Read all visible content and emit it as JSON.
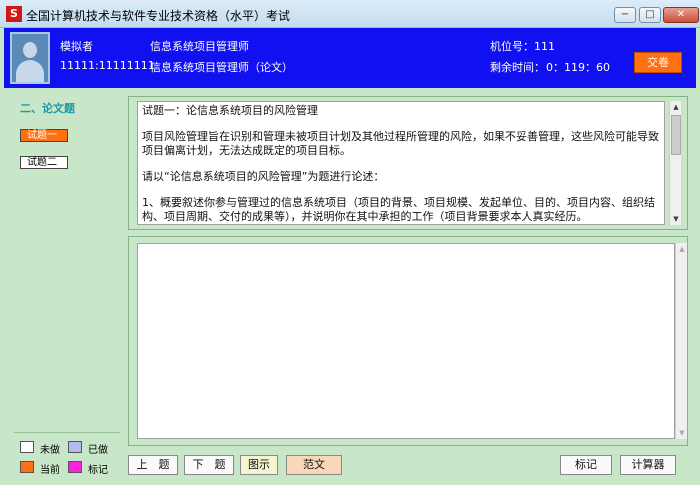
{
  "window": {
    "icon_glyph": "S",
    "title": "全国计算机技术与软件专业技术资格（水平）考试",
    "buttons": {
      "minimize": "−",
      "maximize": "□",
      "close": "✕"
    }
  },
  "header": {
    "name": "模拟者",
    "id": "11111:11111111",
    "exam_name": "信息系统项目管理师",
    "exam_paper": "信息系统项目管理师（论文）",
    "seat_label": "机位号：111",
    "time_label": "剩余时间：",
    "time_value": "0：119：60",
    "submit_label": "交卷"
  },
  "sidebar": {
    "section_title": "二、论文题",
    "questions": [
      "试题一",
      "试题二"
    ]
  },
  "legend": {
    "unanswered": "未做",
    "answered": "已做",
    "current": "当前",
    "marked": "标记",
    "colors": {
      "unanswered": "#ffffff",
      "answered": "#b8b8f0",
      "current": "#ff7010",
      "marked": "#ff20e0"
    }
  },
  "question": {
    "title": "试题一：论信息系统项目的风险管理",
    "para1": "项目风险管理旨在识别和管理未被项目计划及其他过程所管理的风险，如果不妥善管理，这些风险可能导致项目偏离计划，无法达成既定的项目目标。",
    "para2": "请以“论信息系统项目的风险管理”为题进行论述：",
    "para3": "1、概要叙述你参与管理过的信息系统项目（项目的背景、项目规模、发起单位、目的、项目内容、组织结构、项目周期、交付的成果等），并说明你在其中承担的工作（项目背景要求本人真实经历。"
  },
  "bottom_buttons": {
    "prev": "上　题",
    "next": "下　题",
    "hint": "图示",
    "sample": "范文",
    "mark": "标记",
    "calculator": "计算器"
  }
}
